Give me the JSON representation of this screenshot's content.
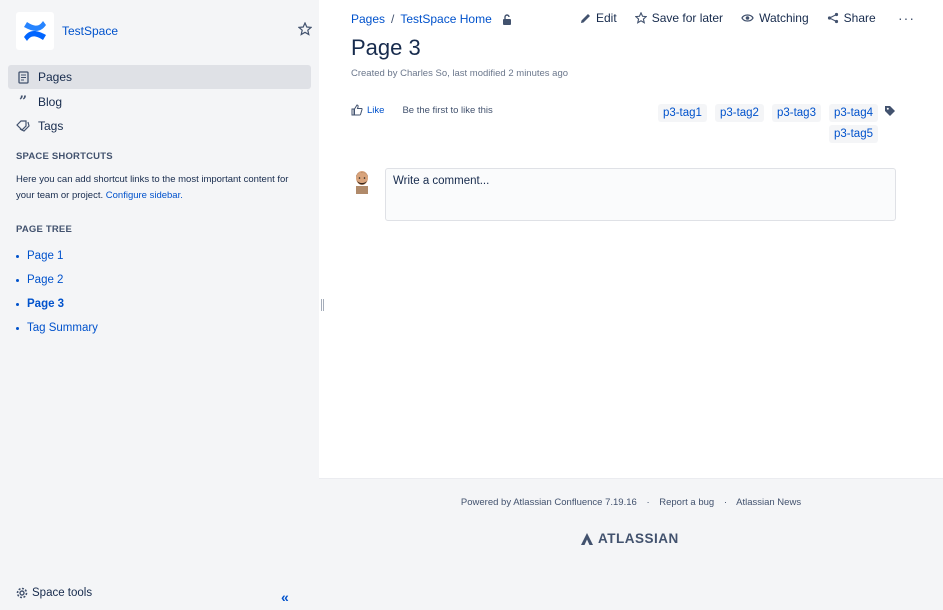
{
  "space": {
    "name": "TestSpace"
  },
  "nav": {
    "pages": "Pages",
    "blog": "Blog",
    "tags": "Tags"
  },
  "shortcuts": {
    "title": "SPACE SHORTCUTS",
    "text": "Here you can add shortcut links to the most important content for your team or project.",
    "link": "Configure sidebar."
  },
  "page_tree": {
    "title": "PAGE TREE",
    "items": [
      "Page 1",
      "Page 2",
      "Page 3",
      "Tag Summary"
    ]
  },
  "sidebar_footer": {
    "space_tools": "Space tools",
    "collapse": "«"
  },
  "breadcrumbs": {
    "pages": "Pages",
    "separator": "/",
    "home": "TestSpace Home"
  },
  "actions": {
    "edit": "Edit",
    "save_for_later": "Save for later",
    "watching": "Watching",
    "share": "Share",
    "more": "···"
  },
  "page": {
    "title": "Page 3",
    "byline": "Created by Charles So, last modified 2 minutes ago"
  },
  "likes": {
    "like": "Like",
    "text": "Be the first to like this"
  },
  "labels": [
    "p3-tag1",
    "p3-tag2",
    "p3-tag3",
    "p3-tag4",
    "p3-tag5"
  ],
  "comment": {
    "placeholder": "Write a comment..."
  },
  "footer": {
    "powered": "Powered by Atlassian Confluence 7.19.16",
    "dot": "·",
    "report": "Report a bug",
    "news": "Atlassian News",
    "logo": "ATLASSIAN"
  },
  "colors": {
    "accent": "#0052cc",
    "sidebar_bg": "#f4f5f7",
    "text": "#172b4d"
  }
}
